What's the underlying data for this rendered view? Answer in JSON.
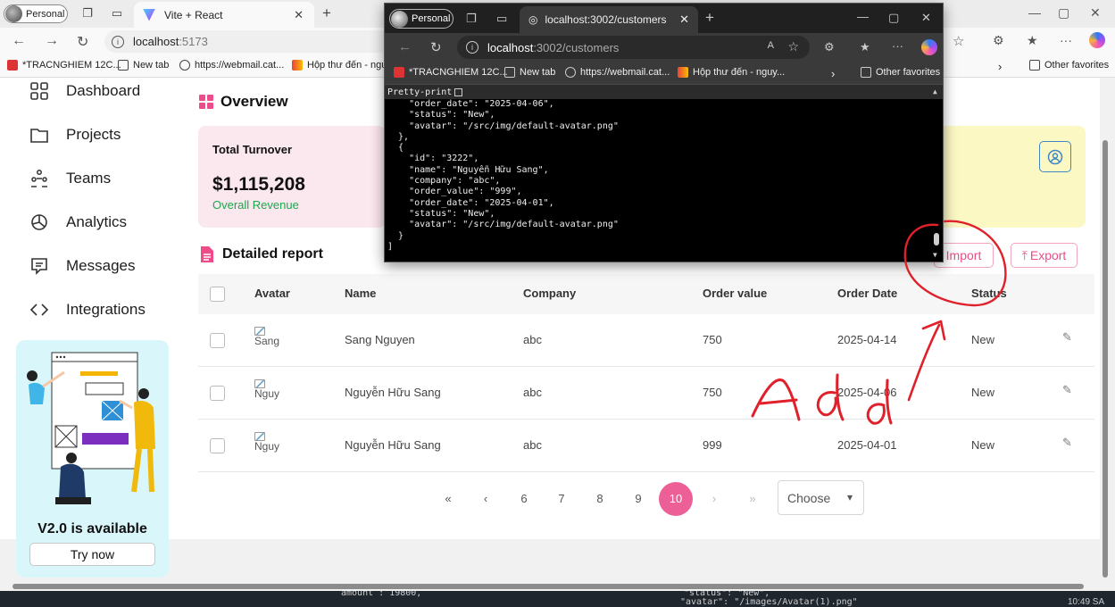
{
  "browser": {
    "profile": "Personal",
    "tab_title": "Vite + React",
    "url_host": "localhost",
    "url_port": ":5173",
    "favorites": [
      "*TRACNGHIEM 12C...",
      "New tab",
      "https://webmail.cat...",
      "Hộp thư đến - nguy..."
    ],
    "other_favorites": "Other favorites"
  },
  "popup": {
    "profile": "Personal",
    "tab_title": "localhost:3002/customers",
    "url_host": "localhost",
    "url_path": ":3002/customers",
    "favorites": [
      "*TRACNGHIEM 12C...",
      "New tab",
      "https://webmail.cat...",
      "Hộp thư đến - nguy..."
    ],
    "other_favorites": "Other favorites",
    "pretty_print": "Pretty-print",
    "json_lines": [
      "    \"order_date\": \"2025-04-06\",",
      "    \"status\": \"New\",",
      "    \"avatar\": \"/src/img/default-avatar.png\"",
      "  },",
      "  {",
      "    \"id\": \"3222\",",
      "    \"name\": \"Nguyễn Hữu Sang\",",
      "    \"company\": \"abc\",",
      "    \"order_value\": \"999\",",
      "    \"order_date\": \"2025-04-01\",",
      "    \"status\": \"New\",",
      "    \"avatar\": \"/src/img/default-avatar.png\"",
      "  }",
      "]"
    ]
  },
  "sidebar": {
    "items": [
      {
        "label": "Dashboard",
        "icon": "grid-icon"
      },
      {
        "label": "Projects",
        "icon": "folder-icon"
      },
      {
        "label": "Teams",
        "icon": "team-icon"
      },
      {
        "label": "Analytics",
        "icon": "pie-chart-icon"
      },
      {
        "label": "Messages",
        "icon": "message-icon"
      },
      {
        "label": "Integrations",
        "icon": "code-icon"
      }
    ],
    "promo_title": "V2.0 is available",
    "promo_button": "Try now"
  },
  "overview": {
    "title": "Overview",
    "card_label": "Total Turnover",
    "card_value": "$1,115,208",
    "card_sub": "Overall Revenue"
  },
  "report": {
    "title": "Detailed report",
    "import_label": "Import",
    "export_label": "Export",
    "columns": [
      "Avatar",
      "Name",
      "Company",
      "Order value",
      "Order Date",
      "Status"
    ],
    "rows": [
      {
        "avatar_alt": "Sang",
        "name": "Sang Nguyen",
        "company": "abc",
        "order_value": "750",
        "order_date": "2025-04-14",
        "status": "New"
      },
      {
        "avatar_alt": "Nguy",
        "name": "Nguyễn Hữu Sang",
        "company": "abc",
        "order_value": "750",
        "order_date": "2025-04-06",
        "status": "New"
      },
      {
        "avatar_alt": "Nguy",
        "name": "Nguyễn Hữu Sang",
        "company": "abc",
        "order_value": "999",
        "order_date": "2025-04-01",
        "status": "New"
      }
    ]
  },
  "pagination": {
    "first": "«",
    "prev": "‹",
    "pages": [
      "6",
      "7",
      "8",
      "9",
      "10"
    ],
    "active_page": "10",
    "next": "›",
    "last": "»",
    "select_label": "Choose"
  },
  "annotation": {
    "text": "Add",
    "color": "#e0202a"
  },
  "colors": {
    "accent": "#ec4c8a",
    "success": "#1ba84c",
    "info": "#3f86c7"
  },
  "taskbar_snippets": [
    "amount : 19800,",
    "\"status\": \"New\",",
    "\"avatar\": \"/images/Avatar(1).png\"",
    "10:49 SA"
  ]
}
